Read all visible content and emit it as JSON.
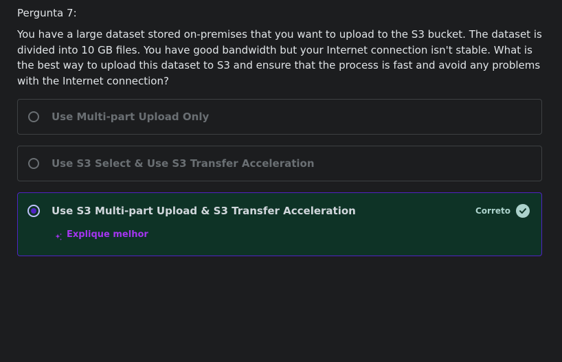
{
  "question": {
    "label": "Pergunta 7:",
    "text": "You have a large dataset stored on-premises that you want to upload to the S3 bucket. The dataset is divided into 10 GB files. You have good bandwidth but your Internet connection isn't stable. What is the best way to upload this dataset to S3 and ensure that the process is fast and avoid any problems with the Internet connection?"
  },
  "options": [
    {
      "label": "Use Multi-part Upload Only",
      "selected": false
    },
    {
      "label": "Use S3 Select & Use S3 Transfer Acceleration",
      "selected": false
    },
    {
      "label": "Use S3 Multi-part Upload & S3 Transfer Acceleration",
      "selected": true
    }
  ],
  "result": {
    "status_label": "Correto",
    "explain_label": "Explique melhor",
    "status_icon": "check-circle-icon",
    "explain_icon": "sparkle-icon"
  },
  "colors": {
    "background": "#1c1d1f",
    "correct_background": "#0e3326",
    "correct_border": "#5022c3",
    "accent": "#a435f0",
    "success": "#acd2cc"
  }
}
